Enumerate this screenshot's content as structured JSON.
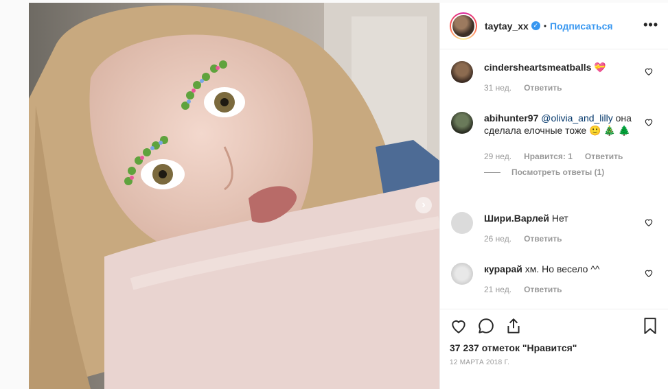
{
  "header": {
    "username": "taytay_xx",
    "separator": "•",
    "follow_label": "Подписаться",
    "more_label": "•••"
  },
  "comments": [
    {
      "user": "cindersheartsmeatballs",
      "text": "💝",
      "time": "31 нед.",
      "likes": "",
      "reply_label": "Ответить"
    },
    {
      "user": "abihunter97",
      "mention": "@olivia_and_lilly",
      "text": "она сделала елочные тоже 🙂 🎄 🌲",
      "time": "29 нед.",
      "likes": "Нравится: 1",
      "reply_label": "Ответить",
      "view_replies": "Посмотреть ответы (1)"
    },
    {
      "user": "Шири.Варлей",
      "text": "Нет",
      "time": "26 нед.",
      "likes": "",
      "reply_label": "Ответить"
    },
    {
      "user": "курарай",
      "text": "хм. Но весело ^^",
      "time": "21 нед.",
      "likes": "",
      "reply_label": "Ответить"
    }
  ],
  "footer": {
    "likes_text": "37 237 отметок \"Нравится\"",
    "date_text": "12 МАРТА 2018 Г."
  },
  "icons": {
    "like": "heart-icon",
    "comment": "comment-bubble-icon",
    "share": "share-icon",
    "save": "bookmark-icon",
    "next": "chevron-right-icon",
    "verified": "verified-badge-icon"
  },
  "colors": {
    "accent": "#3897f0",
    "text": "#262626",
    "muted": "#999999",
    "border": "#efefef"
  }
}
